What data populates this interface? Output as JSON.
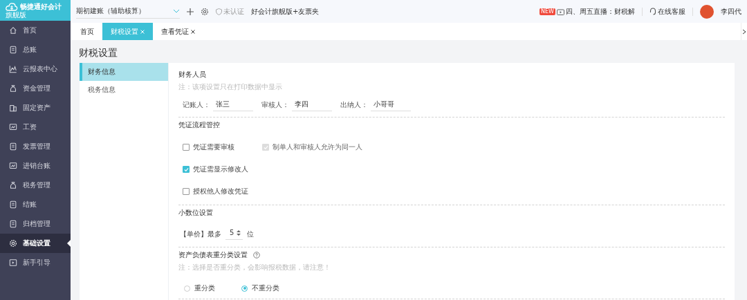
{
  "logo": {
    "name": "畅捷通好会计",
    "edition": "旗舰版"
  },
  "topbar": {
    "account": "期初建账（辅助核算）",
    "cert_status": "未认证",
    "product": "好会计旗舰版+友票夹",
    "live_badge": "NEW",
    "live": "四、周五直播：财税解",
    "service": "在线客服",
    "user": "李四代"
  },
  "sidebar": {
    "items": [
      {
        "label": "首页",
        "selected": false
      },
      {
        "label": "总账",
        "selected": false
      },
      {
        "label": "云报表中心",
        "selected": false
      },
      {
        "label": "资金管理",
        "selected": false
      },
      {
        "label": "固定资产",
        "selected": false
      },
      {
        "label": "工资",
        "selected": false
      },
      {
        "label": "发票管理",
        "selected": false
      },
      {
        "label": "进销台账",
        "selected": false
      },
      {
        "label": "税务管理",
        "selected": false
      },
      {
        "label": "结账",
        "selected": false
      },
      {
        "label": "归档管理",
        "selected": false
      },
      {
        "label": "基础设置",
        "selected": true
      },
      {
        "label": "新手引导",
        "selected": false
      }
    ]
  },
  "tabs": [
    {
      "label": "首页",
      "selected": false,
      "closable": false
    },
    {
      "label": "财税设置",
      "selected": true,
      "closable": true
    },
    {
      "label": "查看凭证",
      "selected": false,
      "closable": true
    }
  ],
  "page_title": "财税设置",
  "subnav": [
    {
      "label": "财务信息",
      "selected": true
    },
    {
      "label": "税务信息",
      "selected": false
    }
  ],
  "sections": [
    {
      "kind": "people",
      "title": "财务人员",
      "note": "注：该项设置只在打印数据中显示",
      "fields": [
        {
          "label": "记账人：",
          "value": "张三"
        },
        {
          "label": "审核人：",
          "value": "李四"
        },
        {
          "label": "出纳人：",
          "value": "小哥哥"
        }
      ]
    },
    {
      "kind": "checks",
      "title": "凭证流程管控",
      "rows": [
        [
          {
            "label": "凭证需要审核",
            "checked": false,
            "disabled": false
          },
          {
            "label": "制单人和审核人允许为同一人",
            "checked": true,
            "disabled": true
          }
        ],
        [
          {
            "label": "凭证需显示修改人",
            "checked": true,
            "disabled": false
          }
        ],
        [
          {
            "label": "授权他人修改凭证",
            "checked": false,
            "disabled": false
          }
        ]
      ]
    },
    {
      "kind": "decimal",
      "title": "小数位设置",
      "prefix": "【单价】最多",
      "value": "5",
      "suffix": "位"
    },
    {
      "kind": "radios",
      "title": "资产负债表重分类设置",
      "help": true,
      "note": "注：选择是否重分类，会影响报税数据，请注意！",
      "options": [
        {
          "label": "重分类",
          "selected": false
        },
        {
          "label": "不重分类",
          "selected": true
        }
      ]
    }
  ]
}
